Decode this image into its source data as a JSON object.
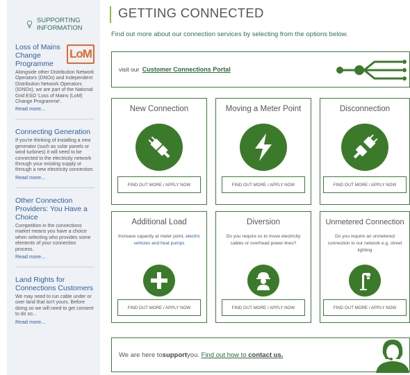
{
  "sidebar": {
    "header": "SUPPORTING INFORMATION",
    "items": [
      {
        "title": "Loss of Mains Change Programme",
        "logo_text": "LoM",
        "body": "Alongside other Distribution Network Operators (DNOs) and Independent Distribution Network Operators (IDNOs), we are part of the National Grid ESO 'Loss of Mains (LoM) Change Programme'.",
        "more": "Read more..."
      },
      {
        "title": "Connecting Generation",
        "body": "If you're thinking of installing a new generator (such as solar panels or wind turbines) it will need to be connected to the electricity network through your existing supply or through a new electricity connection.",
        "more": "Read more..."
      },
      {
        "title": "Other Connection Providers: You Have a Choice",
        "body": "Competition in the connections market means you have a choice when selecting who provides some elements of your connection process.",
        "more": "Read more..."
      },
      {
        "title": "Land Rights for Connections Customers",
        "body": "We may need to run cable under or over land that isn't yours. Before doing so we will need to get consent to do so...",
        "more": "Read more..."
      }
    ]
  },
  "main": {
    "title": "GETTING CONNECTED",
    "intro": "Find out more about our connection services by selecting from the options below.",
    "portal": {
      "prefix": "visit our ",
      "link": "Customer Connections Portal"
    },
    "cards": [
      {
        "title": "New Connection",
        "icon": "plug-icon",
        "button": "FIND OUT MORE / APPLY NOW"
      },
      {
        "title": "Moving a Meter Point",
        "icon": "lightning-icon",
        "button": "FIND OUT MORE / APPLY NOW"
      },
      {
        "title": "Disconnection",
        "icon": "unplug-icon",
        "button": "FIND OUT MORE / APPLY NOW"
      },
      {
        "title": "Additional Load",
        "desc_pre": "Increase capacity at meter point, ",
        "desc_link": "electric vehicles and heat pumps",
        "icon": "plus-icon",
        "button": "FIND OUT MORE / APPLY NOW"
      },
      {
        "title": "Diversion",
        "desc": "Do you require us to move electricity cables or overhead power lines?",
        "icon": "worker-icon",
        "button": "FIND OUT MORE / APPLY NOW"
      },
      {
        "title": "Unmetered Connection",
        "desc": "Do you require an unmetered connection to our network e.g. street lighting",
        "icon": "street-light-icon",
        "button": "FIND OUT MORE / APPLY NOW"
      }
    ],
    "support": {
      "prefix": "We are here to ",
      "bold": "support",
      "mid": " you. ",
      "link_pre": "Find out how to ",
      "link_bold": "contact us."
    }
  },
  "colors": {
    "accent_green": "#3c7a2b",
    "link_blue": "#2f5f98",
    "lom_orange": "#e0692a"
  }
}
